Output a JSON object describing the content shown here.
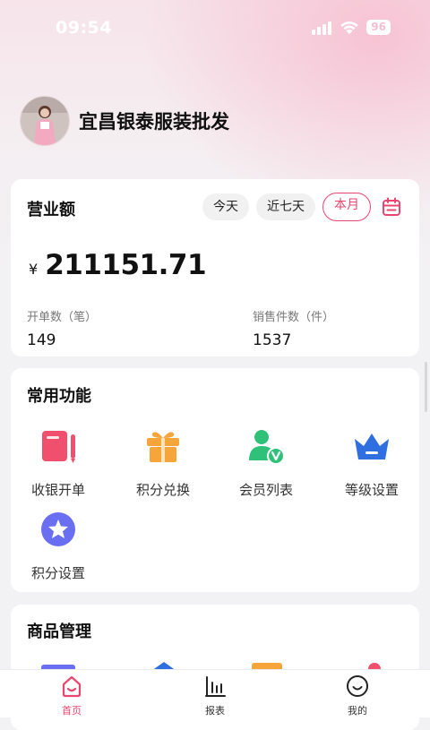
{
  "status": {
    "time": "09:54",
    "battery": "96"
  },
  "store": {
    "name": "宜昌银泰服装批发"
  },
  "revenue": {
    "title": "营业额",
    "periods": [
      "今天",
      "近七天",
      "本月"
    ],
    "active_period": "本月",
    "currency": "¥",
    "amount": "211151.71",
    "orders_label": "开单数（笔）",
    "orders_value": "149",
    "items_label": "销售件数（件）",
    "items_value": "1537"
  },
  "functions": {
    "title": "常用功能",
    "items": [
      {
        "label": "收银开单",
        "icon": "cashier-icon"
      },
      {
        "label": "积分兑换",
        "icon": "gift-icon"
      },
      {
        "label": "会员列表",
        "icon": "member-icon"
      },
      {
        "label": "等级设置",
        "icon": "crown-icon"
      },
      {
        "label": "积分设置",
        "icon": "star-icon"
      }
    ]
  },
  "goods": {
    "title": "商品管理"
  },
  "tabbar": {
    "items": [
      {
        "label": "首页",
        "icon": "home-icon",
        "active": true
      },
      {
        "label": "报表",
        "icon": "chart-icon",
        "active": false
      },
      {
        "label": "我的",
        "icon": "profile-icon",
        "active": false
      }
    ]
  },
  "colors": {
    "accent": "#e8456f",
    "red": "#f0506e",
    "orange": "#f6a53a",
    "green": "#2fc17a",
    "blue": "#2f6fe0",
    "purple": "#6a6ef0"
  }
}
